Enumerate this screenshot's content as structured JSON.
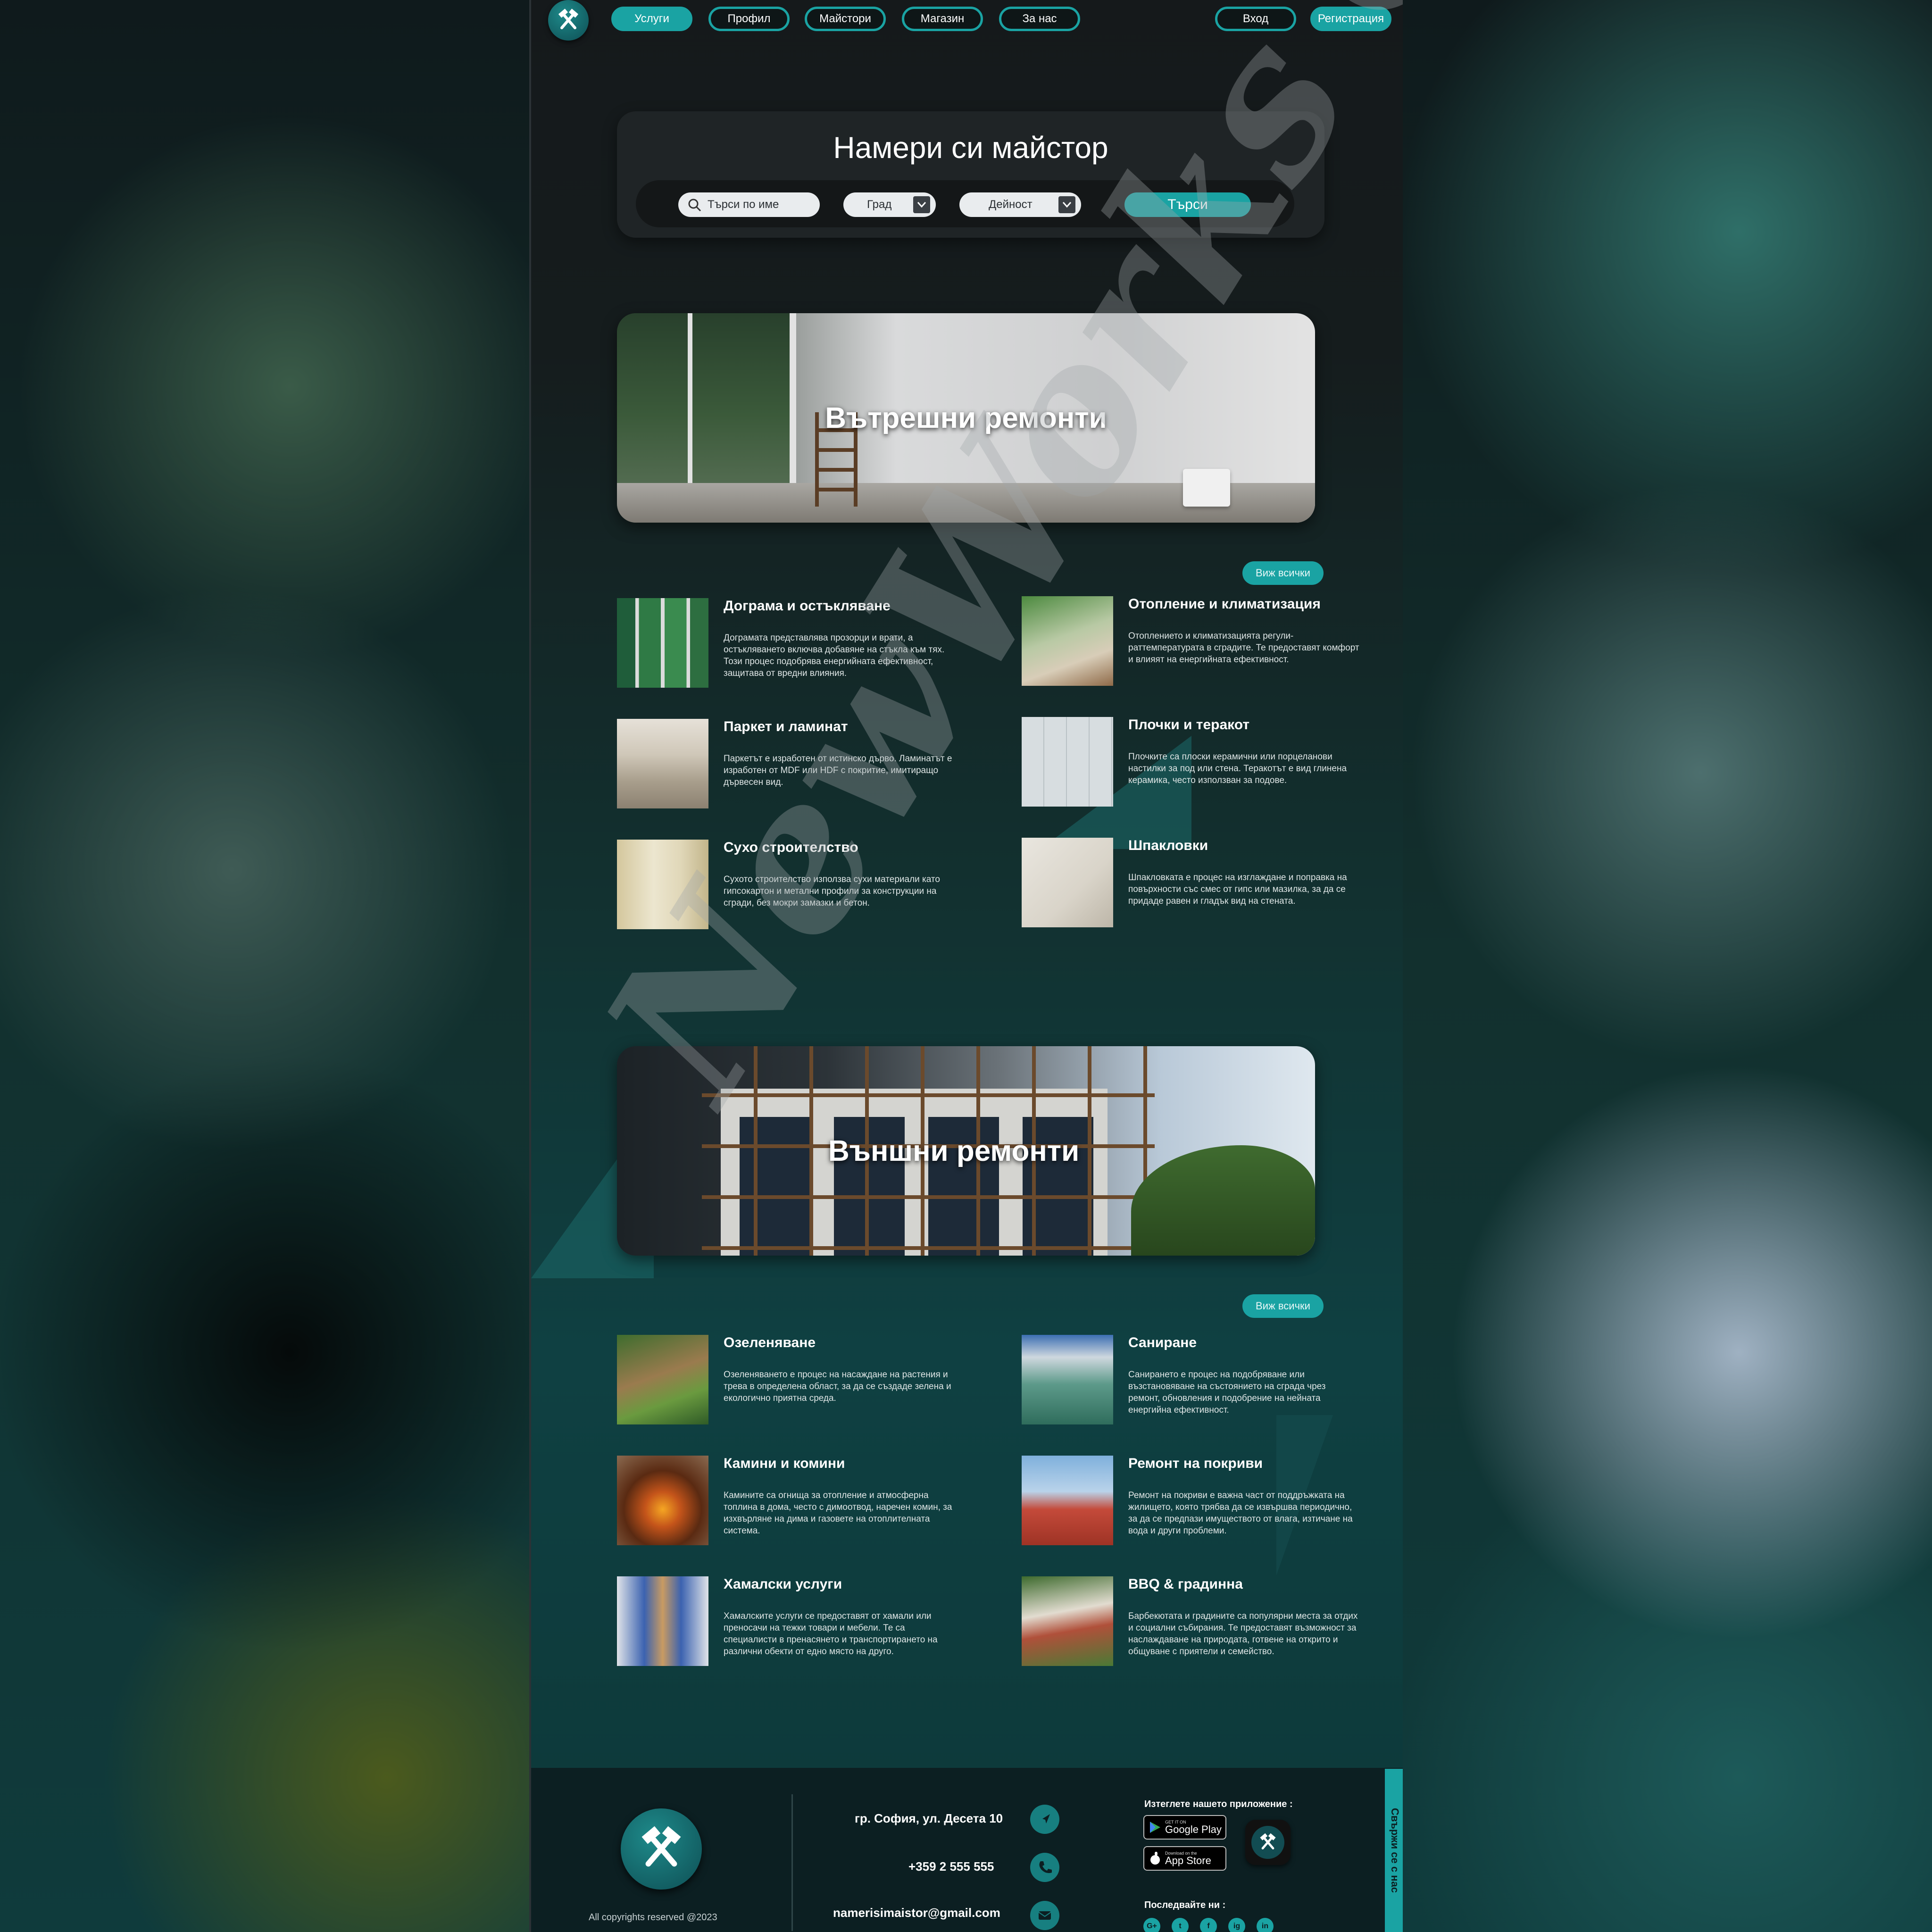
{
  "nav": {
    "items": [
      "Услуги",
      "Профил",
      "Майстори",
      "Магазин",
      "За нас"
    ],
    "login": "Вход",
    "register": "Регистрация"
  },
  "search": {
    "title": "Намери си майстор",
    "name_placeholder": "Търси по име",
    "city_label": "Град",
    "activity_label": "Дейност",
    "button": "Търси"
  },
  "interior": {
    "banner_title": "Вътрешни ремонти",
    "view_all": "Виж всички",
    "items": [
      {
        "title": "Дограма и остъкляване",
        "desc": "Дограмата представлява прозорци и врати, а остъкляването включва добавяне на стъкла към тях. Този процес подобрява енергийната ефективност, защитава от вредни влияния."
      },
      {
        "title": "Отопление и климатизация",
        "desc": "Отоплението и климатизацията регули-раттемпературата в сградите. Те предоставят комфорт и влияят на енергийната ефективност."
      },
      {
        "title": "Паркет и ламинат",
        "desc": "Паркетът е изработен от истинско дърво. Ламинатът е изработен от MDF или HDF с покритие, имитиращо дървесен вид."
      },
      {
        "title": "Плочки и теракот",
        "desc": "Плочките са плоски керамични или порцеланови настилки за под или стена. Теракотът е вид глинена керамика, често използван за подове."
      },
      {
        "title": "Сухо строителство",
        "desc": "Сухото строителство използва сухи материали като гипсокартон и метални профили за конструкции на сгради, без мокри замазки и бетон."
      },
      {
        "title": "Шпакловки",
        "desc": "Шпакловката е процес на изглаждане и поправка на повърхности със смес от гипс или мазилка, за да се придаде равен и гладък вид на стената."
      }
    ]
  },
  "exterior": {
    "banner_title": "Външни ремонти",
    "view_all": "Виж всички",
    "items": [
      {
        "title": "Озеленяване",
        "desc": "Озеленяването е процес на насаждане на растения и трева в определена област, за да се създаде зелена и екологично приятна среда."
      },
      {
        "title": "Саниране",
        "desc": "Санирането е процес на подобряване или възстановяване на състоянието на сграда чрез ремонт, обновления и подобрение на нейната енергийна ефективност."
      },
      {
        "title": "Камини и комини",
        "desc": "Камините са огнища за отопление и атмосферна топлина в дома, често с димоотвод, наречен комин, за изхвърляне на дима и газовете на отоплителната система."
      },
      {
        "title": "Ремонт на покриви",
        "desc": "Ремонт на покриви е важна част от поддръжката на жилището, която трябва да се извършва периодично, за да се предпази имуществото от влага, изтичане на вода и други проблеми."
      },
      {
        "title": "Хамалски услуги",
        "desc": "Хамалските услуги се предоставят от хамали или преносачи на тежки товари и мебели. Те са специалисти в пренасянето и транспортирането на различни обекти от едно място на друго."
      },
      {
        "title": "BBQ & градинна",
        "desc": "Барбекютата и градините са популярни места за отдих и социални събирания. Те предоставят възможност за наслаждаване на природата, готвене на открито и общуване с приятели и семейство."
      }
    ]
  },
  "footer": {
    "copyright": "All copyrights reserved @2023",
    "address": "гр. София, ул. Десета 10",
    "phone": "+359 2 555 555",
    "email": "namerisimaistor@gmail.com",
    "app_title": "Изтеглете нашето приложение :",
    "google_small": "GET IT ON",
    "google_big": "Google Play",
    "apple_small": "Download on the",
    "apple_big": "App Store",
    "follow_title": "Последвайте ни :",
    "socials": [
      "G+",
      "t",
      "f",
      "ig",
      "in"
    ],
    "contact_tab": "Свържи се с нас"
  },
  "watermark": "NewWorks Creations",
  "colors": {
    "accent": "#1aa3a3",
    "footer": "#0c1f22"
  }
}
